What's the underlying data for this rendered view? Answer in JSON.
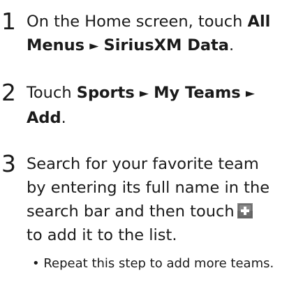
{
  "steps": [
    {
      "number": "1",
      "line1_pre": "On the Home screen, touch ",
      "line1_bold": "All",
      "line2_bold_a": "Menus",
      "arrow": "►",
      "line2_bold_b": "SiriusXM Data",
      "line2_post": "."
    },
    {
      "number": "2",
      "line1_pre": "Touch ",
      "line1_bold_a": "Sports",
      "arrow": "►",
      "line1_bold_b": "My Teams",
      "line2_bold": "Add",
      "line2_post": "."
    },
    {
      "number": "3",
      "line1": "Search for your favorite team",
      "line2": "by entering its full name in the",
      "line3_pre": "search bar and then touch",
      "icon": "add-plus-icon",
      "line4": "to add it to the list."
    }
  ],
  "note": {
    "bullet": "•",
    "text": "Repeat this step to add more teams."
  }
}
